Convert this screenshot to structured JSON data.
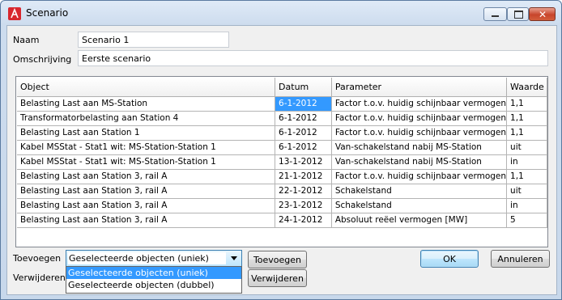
{
  "window": {
    "title": "Scenario"
  },
  "form": {
    "naam_label": "Naam",
    "naam_value": "Scenario 1",
    "omschrijving_label": "Omschrijving",
    "omschrijving_value": "Eerste scenario"
  },
  "table": {
    "headers": [
      "Object",
      "Datum",
      "Parameter",
      "Waarde"
    ],
    "rows": [
      [
        "Belasting Last aan MS-Station",
        "6-1-2012",
        "Factor t.o.v. huidig schijnbaar vermogen",
        "1,1"
      ],
      [
        "Transformatorbelasting  aan Station 4",
        "6-1-2012",
        "Factor t.o.v. huidig schijnbaar vermogen",
        "1,1"
      ],
      [
        "Belasting Last aan Station 1",
        "6-1-2012",
        "Factor t.o.v. huidig schijnbaar vermogen",
        "1,1"
      ],
      [
        "Kabel MSStat - Stat1 wit: MS-Station-Station 1",
        "6-1-2012",
        "Van-schakelstand nabij MS-Station",
        "uit"
      ],
      [
        "Kabel MSStat - Stat1 wit: MS-Station-Station 1",
        "13-1-2012",
        "Van-schakelstand nabij MS-Station",
        "in"
      ],
      [
        "Belasting Last aan Station 3, rail A",
        "21-1-2012",
        "Factor t.o.v. huidig schijnbaar vermogen",
        "1,1"
      ],
      [
        "Belasting Last aan Station 3, rail A",
        "22-1-2012",
        "Schakelstand",
        "uit"
      ],
      [
        "Belasting Last aan Station 3, rail A",
        "23-1-2012",
        "Schakelstand",
        "in"
      ],
      [
        "Belasting Last aan Station 3, rail A",
        "24-1-2012",
        "Absoluut reëel vermogen [MW]",
        "5"
      ]
    ],
    "selected_cell": {
      "row": 0,
      "col": 1
    }
  },
  "actions": {
    "toevoegen_label": "Toevoegen",
    "verwijderen_label": "Verwijderen",
    "combo_value": "Geselecteerde objecten (uniek)",
    "combo_options": [
      "Geselecteerde objecten (uniek)",
      "Geselecteerde objecten (dubbel)"
    ],
    "toevoegen_button": "Toevoegen",
    "verwijderen_button": "Verwijderen",
    "ok_button": "OK",
    "annuleren_button": "Annuleren"
  },
  "colors": {
    "selection": "#3399ff",
    "close_button": "#c8452c",
    "app_icon": "#d8272e"
  },
  "icons": {
    "app": "app-logo-icon",
    "minimize": "minimize-icon",
    "maximize": "maximize-icon",
    "close": "close-icon",
    "dropdown": "chevron-down-icon"
  }
}
